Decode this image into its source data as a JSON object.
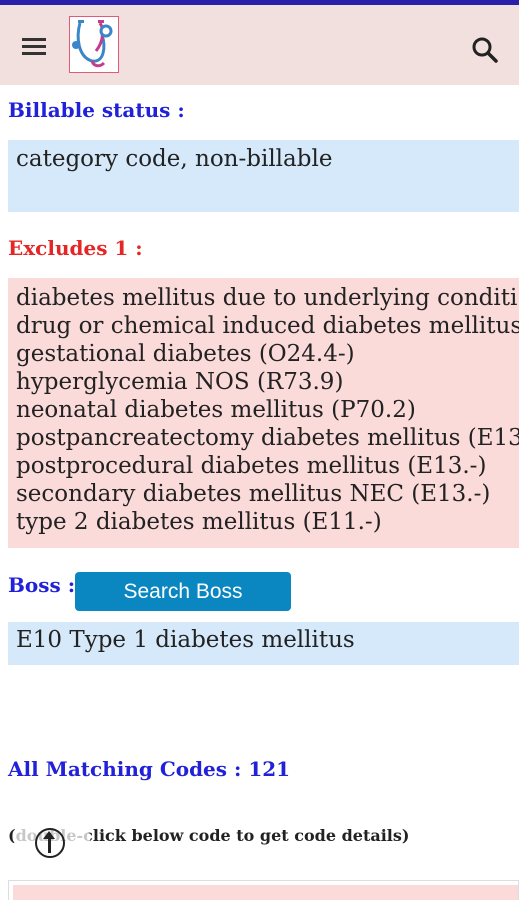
{
  "app_bar": {
    "menu_icon": "hamburger-menu-icon",
    "logo_icon": "stethoscope-icon",
    "search_icon": "search-icon"
  },
  "billable": {
    "label": "Billable status :",
    "value": "category code, non-billable"
  },
  "excludes": {
    "label": "Excludes 1 :",
    "items": [
      "diabetes mellitus due to underlying conditi",
      "drug or chemical induced diabetes mellitus",
      "gestational diabetes (O24.4-)",
      "hyperglycemia NOS (R73.9)",
      "neonatal diabetes mellitus (P70.2)",
      "postpancreatectomy diabetes mellitus (E13.",
      "postprocedural diabetes mellitus (E13.-)",
      "secondary diabetes mellitus NEC (E13.-)",
      "type 2 diabetes mellitus (E11.-)"
    ]
  },
  "boss": {
    "label": "Boss :",
    "button_label": "Search Boss",
    "value": "E10 Type 1 diabetes mellitus"
  },
  "matching": {
    "label": "All Matching Codes : 121",
    "hint": "(double-click below code to get code details)"
  },
  "fab": {
    "icon": "scroll-to-top-icon"
  },
  "colors": {
    "status_strip": "#2a1eaa",
    "app_bar": "#f1e0dd",
    "label_blue": "#2121d9",
    "label_red": "#e52626",
    "box_blue": "#d6e9fa",
    "box_pink": "#fbdada",
    "button": "#0a87c0"
  }
}
